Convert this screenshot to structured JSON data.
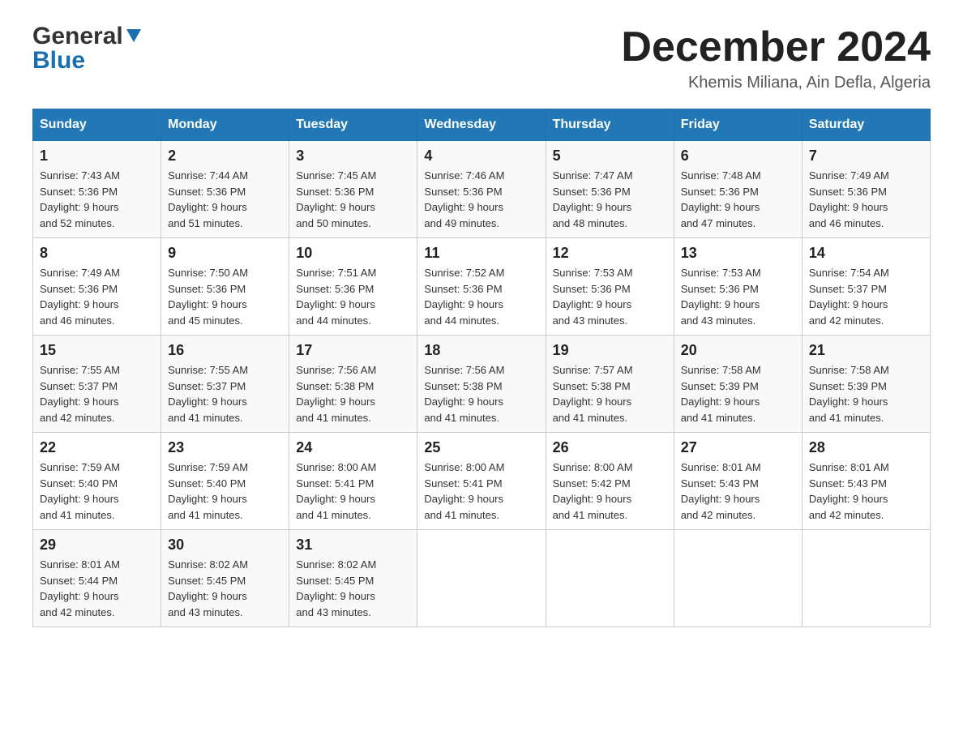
{
  "header": {
    "logo_top": "General",
    "logo_bottom": "Blue",
    "month_title": "December 2024",
    "location": "Khemis Miliana, Ain Defla, Algeria"
  },
  "days_of_week": [
    "Sunday",
    "Monday",
    "Tuesday",
    "Wednesday",
    "Thursday",
    "Friday",
    "Saturday"
  ],
  "weeks": [
    [
      {
        "day": "1",
        "sunrise": "7:43 AM",
        "sunset": "5:36 PM",
        "daylight": "9 hours and 52 minutes."
      },
      {
        "day": "2",
        "sunrise": "7:44 AM",
        "sunset": "5:36 PM",
        "daylight": "9 hours and 51 minutes."
      },
      {
        "day": "3",
        "sunrise": "7:45 AM",
        "sunset": "5:36 PM",
        "daylight": "9 hours and 50 minutes."
      },
      {
        "day": "4",
        "sunrise": "7:46 AM",
        "sunset": "5:36 PM",
        "daylight": "9 hours and 49 minutes."
      },
      {
        "day": "5",
        "sunrise": "7:47 AM",
        "sunset": "5:36 PM",
        "daylight": "9 hours and 48 minutes."
      },
      {
        "day": "6",
        "sunrise": "7:48 AM",
        "sunset": "5:36 PM",
        "daylight": "9 hours and 47 minutes."
      },
      {
        "day": "7",
        "sunrise": "7:49 AM",
        "sunset": "5:36 PM",
        "daylight": "9 hours and 46 minutes."
      }
    ],
    [
      {
        "day": "8",
        "sunrise": "7:49 AM",
        "sunset": "5:36 PM",
        "daylight": "9 hours and 46 minutes."
      },
      {
        "day": "9",
        "sunrise": "7:50 AM",
        "sunset": "5:36 PM",
        "daylight": "9 hours and 45 minutes."
      },
      {
        "day": "10",
        "sunrise": "7:51 AM",
        "sunset": "5:36 PM",
        "daylight": "9 hours and 44 minutes."
      },
      {
        "day": "11",
        "sunrise": "7:52 AM",
        "sunset": "5:36 PM",
        "daylight": "9 hours and 44 minutes."
      },
      {
        "day": "12",
        "sunrise": "7:53 AM",
        "sunset": "5:36 PM",
        "daylight": "9 hours and 43 minutes."
      },
      {
        "day": "13",
        "sunrise": "7:53 AM",
        "sunset": "5:36 PM",
        "daylight": "9 hours and 43 minutes."
      },
      {
        "day": "14",
        "sunrise": "7:54 AM",
        "sunset": "5:37 PM",
        "daylight": "9 hours and 42 minutes."
      }
    ],
    [
      {
        "day": "15",
        "sunrise": "7:55 AM",
        "sunset": "5:37 PM",
        "daylight": "9 hours and 42 minutes."
      },
      {
        "day": "16",
        "sunrise": "7:55 AM",
        "sunset": "5:37 PM",
        "daylight": "9 hours and 41 minutes."
      },
      {
        "day": "17",
        "sunrise": "7:56 AM",
        "sunset": "5:38 PM",
        "daylight": "9 hours and 41 minutes."
      },
      {
        "day": "18",
        "sunrise": "7:56 AM",
        "sunset": "5:38 PM",
        "daylight": "9 hours and 41 minutes."
      },
      {
        "day": "19",
        "sunrise": "7:57 AM",
        "sunset": "5:38 PM",
        "daylight": "9 hours and 41 minutes."
      },
      {
        "day": "20",
        "sunrise": "7:58 AM",
        "sunset": "5:39 PM",
        "daylight": "9 hours and 41 minutes."
      },
      {
        "day": "21",
        "sunrise": "7:58 AM",
        "sunset": "5:39 PM",
        "daylight": "9 hours and 41 minutes."
      }
    ],
    [
      {
        "day": "22",
        "sunrise": "7:59 AM",
        "sunset": "5:40 PM",
        "daylight": "9 hours and 41 minutes."
      },
      {
        "day": "23",
        "sunrise": "7:59 AM",
        "sunset": "5:40 PM",
        "daylight": "9 hours and 41 minutes."
      },
      {
        "day": "24",
        "sunrise": "8:00 AM",
        "sunset": "5:41 PM",
        "daylight": "9 hours and 41 minutes."
      },
      {
        "day": "25",
        "sunrise": "8:00 AM",
        "sunset": "5:41 PM",
        "daylight": "9 hours and 41 minutes."
      },
      {
        "day": "26",
        "sunrise": "8:00 AM",
        "sunset": "5:42 PM",
        "daylight": "9 hours and 41 minutes."
      },
      {
        "day": "27",
        "sunrise": "8:01 AM",
        "sunset": "5:43 PM",
        "daylight": "9 hours and 42 minutes."
      },
      {
        "day": "28",
        "sunrise": "8:01 AM",
        "sunset": "5:43 PM",
        "daylight": "9 hours and 42 minutes."
      }
    ],
    [
      {
        "day": "29",
        "sunrise": "8:01 AM",
        "sunset": "5:44 PM",
        "daylight": "9 hours and 42 minutes."
      },
      {
        "day": "30",
        "sunrise": "8:02 AM",
        "sunset": "5:45 PM",
        "daylight": "9 hours and 43 minutes."
      },
      {
        "day": "31",
        "sunrise": "8:02 AM",
        "sunset": "5:45 PM",
        "daylight": "9 hours and 43 minutes."
      },
      null,
      null,
      null,
      null
    ]
  ],
  "labels": {
    "sunrise": "Sunrise:",
    "sunset": "Sunset:",
    "daylight": "Daylight:"
  }
}
